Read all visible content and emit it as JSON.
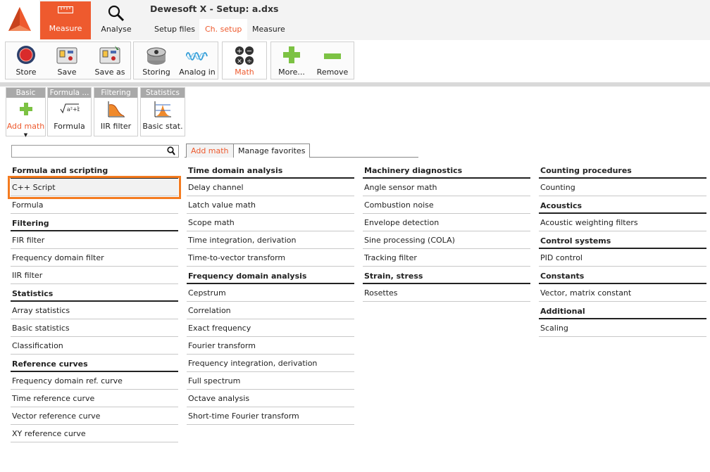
{
  "window": {
    "title": "Dewesoft X - Setup: a.dxs"
  },
  "modes": [
    {
      "label": "Measure",
      "icon": "ruler-icon",
      "active": true
    },
    {
      "label": "Analyse",
      "icon": "magnifier-icon",
      "active": false
    }
  ],
  "tabs": [
    {
      "label": "Setup files",
      "active": false
    },
    {
      "label": "Ch. setup",
      "active": true
    },
    {
      "label": "Measure",
      "active": false
    }
  ],
  "toolbar": {
    "store": "Store",
    "save": "Save",
    "save_as": "Save as",
    "storing": "Storing",
    "analog_in": "Analog in",
    "math": "Math",
    "more": "More...",
    "remove": "Remove"
  },
  "ribbon": [
    {
      "header": "Basic",
      "label": "Add math",
      "icon": "plus-icon",
      "active": true
    },
    {
      "header": "Formula ...",
      "label": "Formula",
      "icon": "formula-icon",
      "active": false
    },
    {
      "header": "Filtering",
      "label": "IIR filter",
      "icon": "filter-icon",
      "active": false
    },
    {
      "header": "Statistics",
      "label": "Basic stat.",
      "icon": "statistics-icon",
      "active": false
    }
  ],
  "search": {
    "value": "",
    "placeholder": ""
  },
  "subtabs": [
    {
      "label": "Add math",
      "active": true
    },
    {
      "label": "Manage favorites",
      "active": false
    }
  ],
  "columns": [
    [
      {
        "title": "Formula and scripting",
        "items": [
          "C++ Script",
          "Formula"
        ]
      },
      {
        "title": "Filtering",
        "items": [
          "FIR filter",
          "Frequency domain filter",
          "IIR filter"
        ]
      },
      {
        "title": "Statistics",
        "items": [
          "Array statistics",
          "Basic statistics",
          "Classification"
        ]
      },
      {
        "title": "Reference curves",
        "items": [
          "Frequency domain ref. curve",
          "Time reference curve",
          "Vector reference curve",
          "XY reference curve"
        ]
      }
    ],
    [
      {
        "title": "Time domain analysis",
        "items": [
          "Delay channel",
          "Latch value math",
          "Scope math",
          "Time integration, derivation",
          "Time-to-vector transform"
        ]
      },
      {
        "title": "Frequency domain analysis",
        "items": [
          "Cepstrum",
          "Correlation",
          "Exact frequency",
          "Fourier transform",
          "Frequency integration, derivation",
          "Full spectrum",
          "Octave analysis",
          "Short-time Fourier transform"
        ]
      }
    ],
    [
      {
        "title": "Machinery diagnostics",
        "items": [
          "Angle sensor math",
          "Combustion noise",
          "Envelope detection",
          "Sine processing (COLA)",
          "Tracking filter"
        ]
      },
      {
        "title": "Strain, stress",
        "items": [
          "Rosettes"
        ]
      }
    ],
    [
      {
        "title": "Counting procedures",
        "items": [
          "Counting"
        ]
      },
      {
        "title": "Acoustics",
        "items": [
          "Acoustic weighting filters"
        ]
      },
      {
        "title": "Control systems",
        "items": [
          "PID control"
        ]
      },
      {
        "title": "Constants",
        "items": [
          "Vector, matrix constant"
        ]
      },
      {
        "title": "Additional",
        "items": [
          "Scaling"
        ]
      }
    ]
  ],
  "highlighted_item": "C++ Script",
  "colors": {
    "accent": "#ee5a2e",
    "highlight_border": "#f47b20",
    "ribbon_header": "#a9a9a9"
  }
}
